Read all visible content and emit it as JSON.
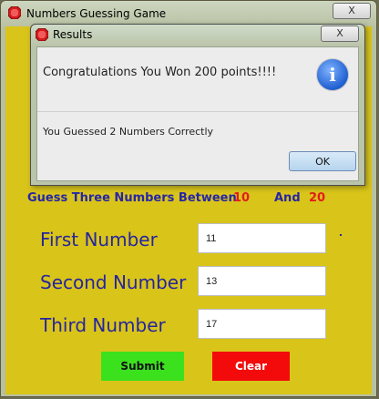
{
  "main_window": {
    "title": "Numbers Guessing Game",
    "close_label": "X"
  },
  "prompt": {
    "text": "Guess Three Numbers Between",
    "low": "10",
    "and_text": "And",
    "high": "20"
  },
  "fields": [
    {
      "label": "First Number",
      "value": "11"
    },
    {
      "label": "Second Number",
      "value": "13"
    },
    {
      "label": "Third Number",
      "value": "17"
    }
  ],
  "buttons": {
    "submit": "Submit",
    "clear": "Clear"
  },
  "dialog": {
    "title": "Results",
    "close_label": "X",
    "message": "Congratulations You Won 200 points!!!!",
    "info_glyph": "i",
    "detail": "You Guessed 2 Numbers Correctly",
    "ok_label": "OK"
  },
  "colors": {
    "panel_background": "#d9c41a",
    "label_text": "#25259e",
    "range_numbers": "#e41b1b",
    "submit_button": "#3ce11e",
    "clear_button": "#f30b0b"
  },
  "icons": {
    "app": "red-octagon-app-icon",
    "dialog_info": "info-icon"
  }
}
